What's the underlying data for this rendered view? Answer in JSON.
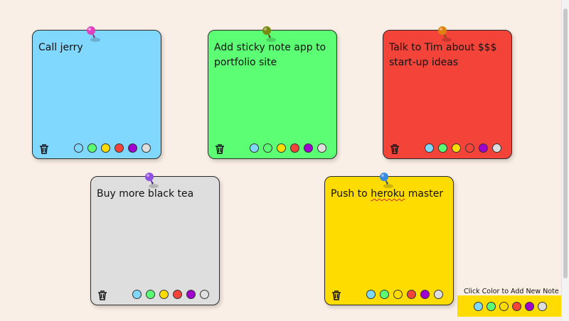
{
  "notes": [
    {
      "text": "Call jerry",
      "color": "#80d8ff",
      "pin_color": "#e040c0"
    },
    {
      "text": "Add sticky note app to portfolio site",
      "color": "#5cff74",
      "pin_color": "#7a8a10"
    },
    {
      "text": "Talk to Tim about $$$ start-up ideas",
      "color": "#f4443a",
      "pin_color": "#e08010"
    },
    {
      "text": "Buy more black tea",
      "color": "#dedede",
      "pin_color": "#9050e0"
    },
    {
      "text_before": "Push to ",
      "text_underlined": "heroku",
      "text_after": " master",
      "color": "#ffdc00",
      "pin_color": "#3a8ae0"
    }
  ],
  "palette_colors": [
    "#80d8ff",
    "#5cff74",
    "#ffdc00",
    "#f4443a",
    "#a000d0",
    "#dedede"
  ],
  "new_note": {
    "label": "Click Color to Add New Note"
  },
  "icons": {
    "delete": "trash-icon",
    "pin": "pushpin-icon"
  }
}
